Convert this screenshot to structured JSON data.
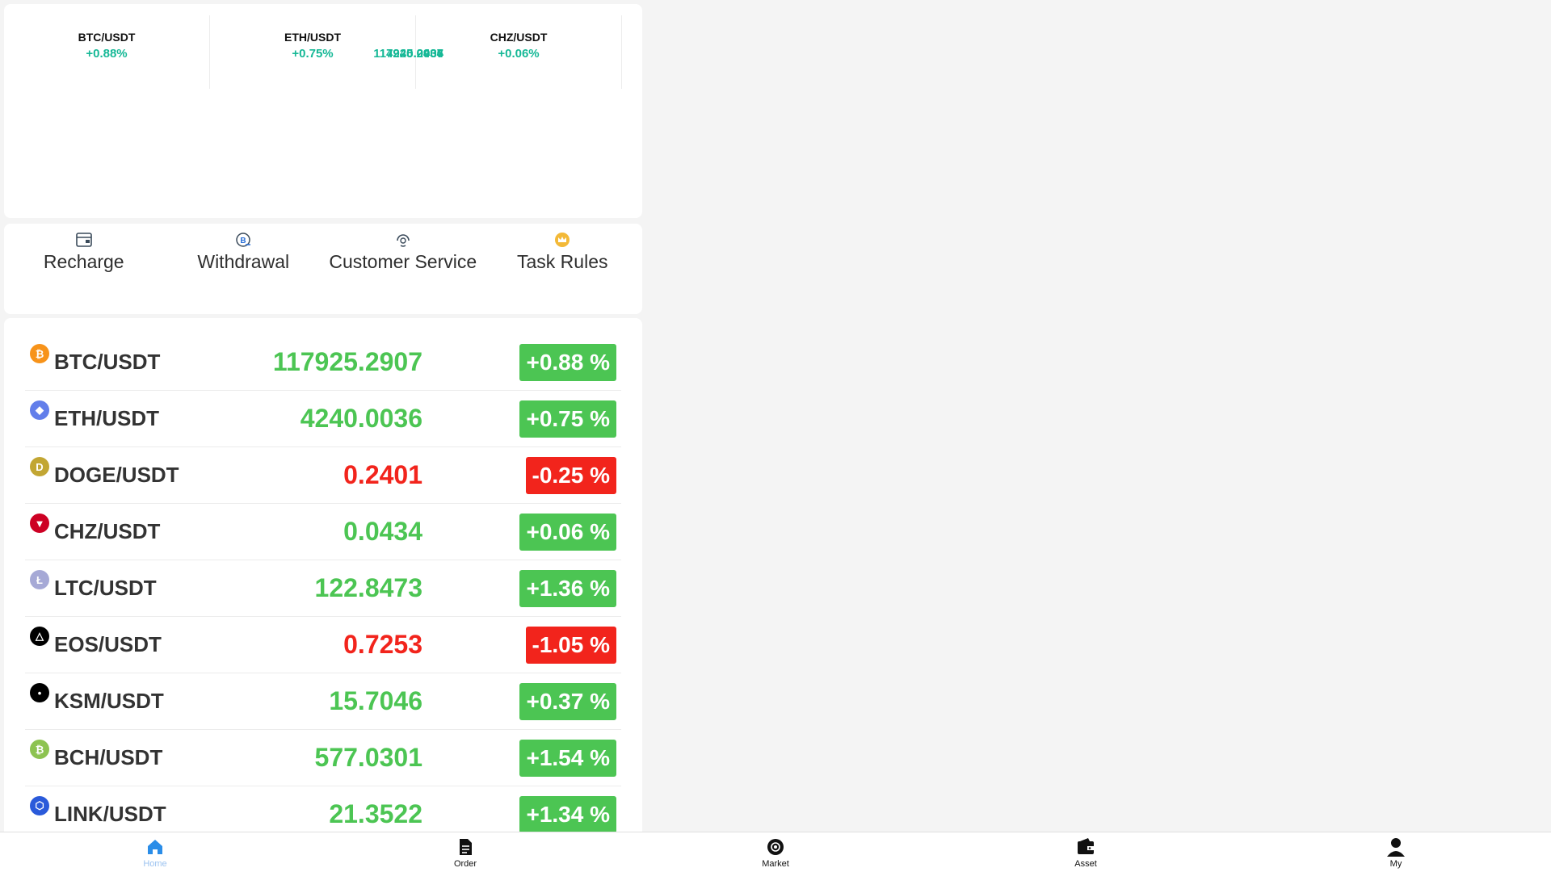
{
  "tickers": [
    {
      "pair": "BTC/USDT",
      "price": "117925.2907",
      "change": "+0.88%"
    },
    {
      "pair": "ETH/USDT",
      "price": "4240.0036",
      "change": "+0.75%"
    },
    {
      "pair": "CHZ/USDT",
      "price": "0.0434",
      "change": "+0.06%"
    }
  ],
  "actions": [
    {
      "label": "Recharge",
      "icon": "wallet-icon"
    },
    {
      "label": "Withdrawal",
      "icon": "bitcoin-withdraw-icon"
    },
    {
      "label": "Customer Service",
      "icon": "headset-icon"
    },
    {
      "label": "Task Rules",
      "icon": "crown-icon"
    }
  ],
  "markets": [
    {
      "pair": "BTC/USDT",
      "price": "117925.2907",
      "change": "+0.88 %",
      "trend": "up",
      "icon": "btc-icon",
      "color": "#f7931a"
    },
    {
      "pair": "ETH/USDT",
      "price": "4240.0036",
      "change": "+0.75 %",
      "trend": "up",
      "icon": "eth-icon",
      "color": "#627eea"
    },
    {
      "pair": "DOGE/USDT",
      "price": "0.2401",
      "change": "-0.25 %",
      "trend": "down",
      "icon": "doge-icon",
      "color": "#c2a633"
    },
    {
      "pair": "CHZ/USDT",
      "price": "0.0434",
      "change": "+0.06 %",
      "trend": "up",
      "icon": "chz-icon",
      "color": "#cd0124"
    },
    {
      "pair": "LTC/USDT",
      "price": "122.8473",
      "change": "+1.36 %",
      "trend": "up",
      "icon": "ltc-icon",
      "color": "#a6a9d6"
    },
    {
      "pair": "EOS/USDT",
      "price": "0.7253",
      "change": "-1.05 %",
      "trend": "down",
      "icon": "eos-icon",
      "color": "#000000"
    },
    {
      "pair": "KSM/USDT",
      "price": "15.7046",
      "change": "+0.37 %",
      "trend": "up",
      "icon": "ksm-icon",
      "color": "#000000"
    },
    {
      "pair": "BCH/USDT",
      "price": "577.0301",
      "change": "+1.54 %",
      "trend": "up",
      "icon": "bch-icon",
      "color": "#8dc351"
    },
    {
      "pair": "LINK/USDT",
      "price": "21.3522",
      "change": "+1.34 %",
      "trend": "up",
      "icon": "link-icon",
      "color": "#2a5ada"
    }
  ],
  "tabbar": [
    {
      "label": "Home",
      "icon": "home-icon",
      "active": true
    },
    {
      "label": "Order",
      "icon": "document-icon"
    },
    {
      "label": "Market",
      "icon": "market-icon"
    },
    {
      "label": "Asset",
      "icon": "wallet-icon"
    },
    {
      "label": "My",
      "icon": "user-icon"
    }
  ],
  "colors": {
    "up": "#4cc553",
    "down": "#f2241c",
    "ticker": "#15b896",
    "active_tab": "#9cc3f0"
  }
}
